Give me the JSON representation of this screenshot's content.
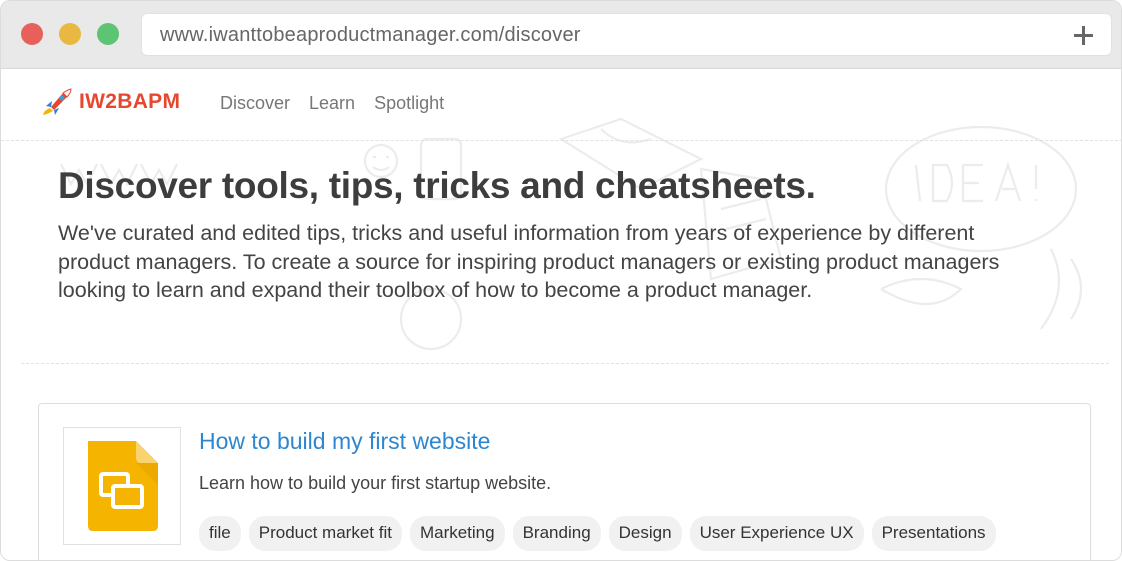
{
  "browser": {
    "url": "www.iwanttobeaproductmanager.com/discover",
    "new_tab_icon": "plus-icon"
  },
  "nav": {
    "logo_text": "IW2BAPM",
    "logo_icon": "rocket-icon",
    "links": [
      "Discover",
      "Learn",
      "Spotlight"
    ]
  },
  "hero": {
    "title": "Discover tools, tips, tricks and cheatsheets.",
    "description": "We've curated and edited tips, tricks and useful information from years of experience by different product managers. To create a source for inspiring product managers or existing product managers looking to learn and expand their toolbox of how to become a product manager."
  },
  "card": {
    "icon": "slides-document-icon",
    "title": "How to build my first website",
    "description": "Learn how to build your first startup website.",
    "tags": [
      "file",
      "Product market fit",
      "Marketing",
      "Branding",
      "Design",
      "User Experience UX",
      "Presentations"
    ]
  },
  "colors": {
    "brand": "#e8472f",
    "link": "#2b87d1",
    "slides_yellow": "#f4b400"
  }
}
